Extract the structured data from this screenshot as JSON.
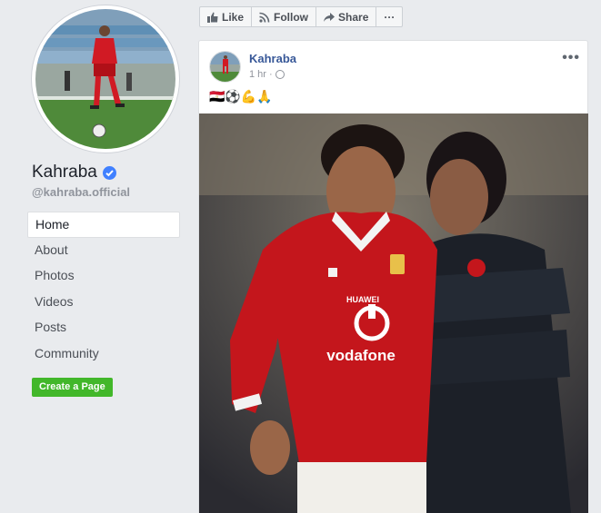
{
  "sidebar": {
    "page_name": "Kahraba",
    "handle": "@kahraba.official",
    "nav": [
      {
        "label": "Home"
      },
      {
        "label": "About"
      },
      {
        "label": "Photos"
      },
      {
        "label": "Videos"
      },
      {
        "label": "Posts"
      },
      {
        "label": "Community"
      }
    ],
    "create_page_label": "Create a Page"
  },
  "actions": {
    "like_label": "Like",
    "follow_label": "Follow",
    "share_label": "Share",
    "more_label": "···"
  },
  "post": {
    "author": "Kahraba",
    "time": "1 hr ·",
    "more_label": "•••",
    "emoji_text": "🇪🇬⚽💪🙏",
    "jersey_brand": "HUAWEI",
    "jersey_sponsor": "vodafone"
  },
  "colors": {
    "link": "#385898",
    "green": "#42b72a",
    "verified": "#4080ff",
    "jersey": "#c4161c"
  }
}
